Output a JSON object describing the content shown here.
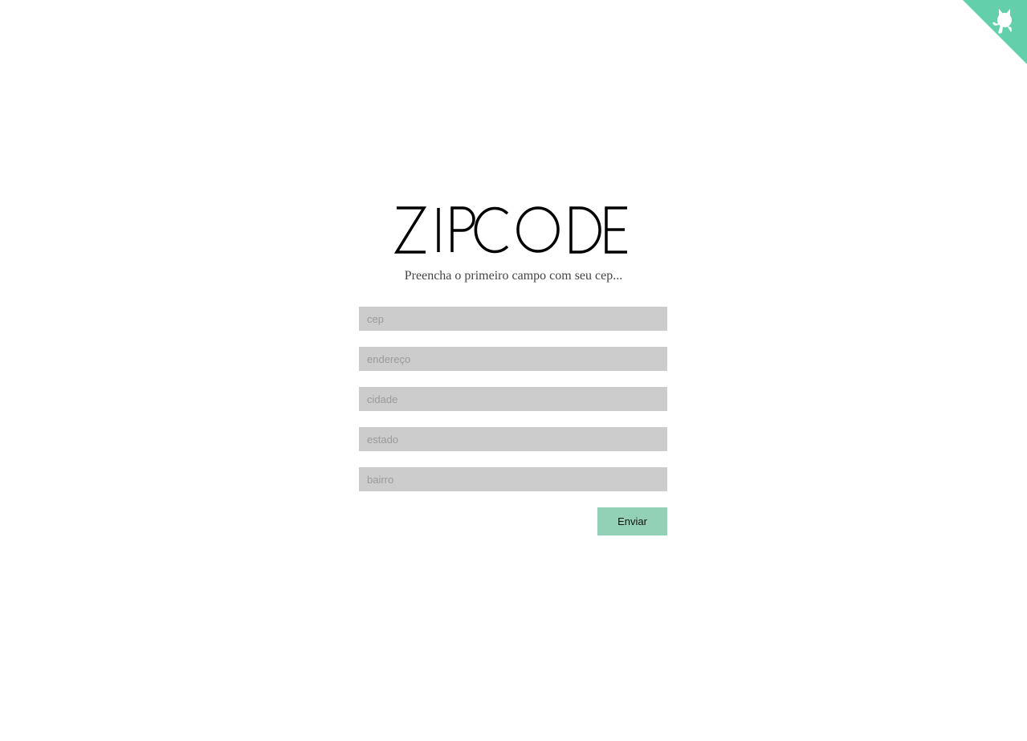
{
  "header": {
    "logo_text": "ZIPCODE",
    "subtitle": "Preencha o primeiro campo com seu cep..."
  },
  "corner_link": {
    "icon": "github-octocat-icon",
    "color": "#64d0ab"
  },
  "form": {
    "fields": [
      {
        "placeholder": "cep",
        "value": ""
      },
      {
        "placeholder": "endereço",
        "value": ""
      },
      {
        "placeholder": "cidade",
        "value": ""
      },
      {
        "placeholder": "estado",
        "value": ""
      },
      {
        "placeholder": "bairro",
        "value": ""
      }
    ],
    "submit_label": "Enviar",
    "submit_color": "#92d1b6",
    "field_color": "#cccccc"
  }
}
